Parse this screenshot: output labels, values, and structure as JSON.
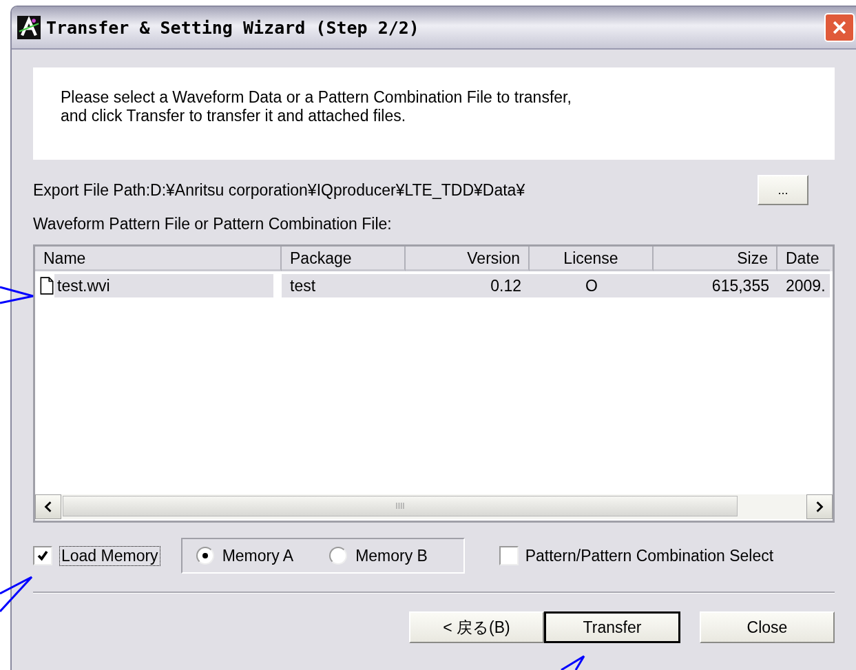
{
  "window": {
    "title": "Transfer & Setting Wizard (Step 2/2)"
  },
  "instructions": [
    "Please select a Waveform Data or a Pattern Combination File to transfer,",
    "and click Transfer to transfer it and attached files."
  ],
  "export_path": {
    "label": "Export File Path:D:¥Anritsu corporation¥IQproducer¥LTE_TDD¥Data¥",
    "browse_button": "..."
  },
  "list_label": "Waveform Pattern File or Pattern Combination File:",
  "table": {
    "columns": [
      {
        "label": "Name"
      },
      {
        "label": "Package"
      },
      {
        "label": "Version"
      },
      {
        "label": "License"
      },
      {
        "label": "Size"
      },
      {
        "label": "Date"
      }
    ],
    "rows": [
      {
        "selected": true,
        "cells": [
          "test.wvi",
          "test",
          "0.12",
          "O",
          "615,355",
          "2009."
        ]
      }
    ]
  },
  "scrollbar_grip": "IIII",
  "load_memory": {
    "label": "Load Memory",
    "checked": true
  },
  "memory": [
    {
      "label": "Memory A",
      "selected": true
    },
    {
      "label": "Memory B",
      "selected": false
    }
  ],
  "pattern_select": {
    "label": "Pattern/Pattern Combination Select",
    "checked": false
  },
  "buttons": [
    {
      "label": "< 戻る(B)",
      "default": false
    },
    {
      "label": "Transfer",
      "default": true
    },
    {
      "label": "Close",
      "default": false
    }
  ]
}
